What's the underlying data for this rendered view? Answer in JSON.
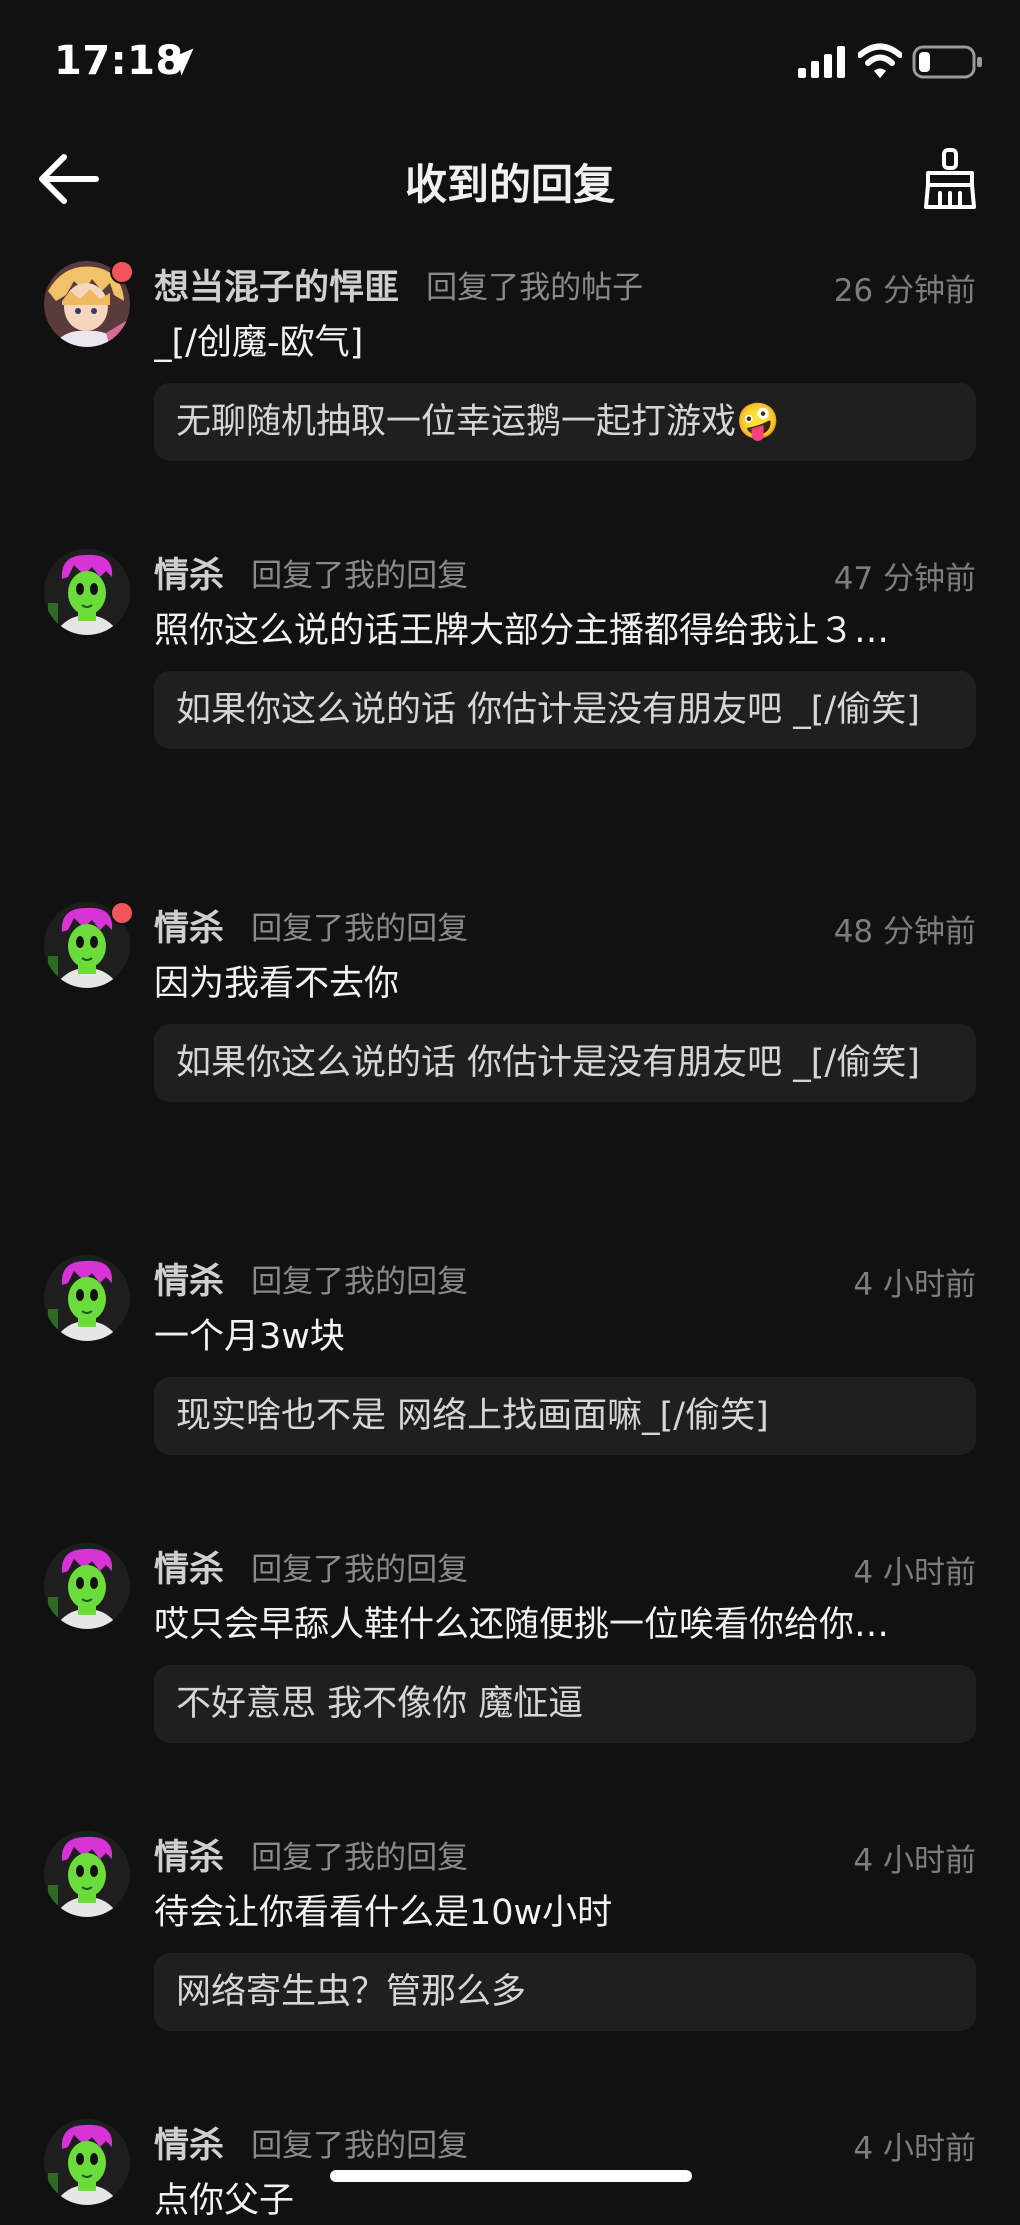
{
  "status_bar": {
    "time": "17:18"
  },
  "nav": {
    "title": "收到的回复"
  },
  "colors": {
    "background": "#111111",
    "quote_background": "#1f1f1f",
    "unread_dot": "#f2545b",
    "avatar_green": "#6bdc3b",
    "avatar_magenta": "#d833d6"
  },
  "replies": [
    {
      "avatar": "anime-blond-avatar",
      "unread": true,
      "username": "想当混子的悍匪",
      "action": "回复了我的帖子",
      "time": "26 分钟前",
      "text": "_[/创魔-欧气]",
      "quote": "无聊随机抽取一位幸运鹅一起打游戏🤪"
    },
    {
      "avatar": "green-magenta-avatar",
      "unread": false,
      "username": "情杀",
      "action": "回复了我的回复",
      "time": "47 分钟前",
      "text": "照你这么说的话王牌大部分主播都得给我让３…",
      "quote": "如果你这么说的话 你估计是没有朋友吧 _[/偷笑]"
    },
    {
      "avatar": "green-magenta-avatar",
      "unread": true,
      "username": "情杀",
      "action": "回复了我的回复",
      "time": "48 分钟前",
      "text": "因为我看不去你",
      "quote": "如果你这么说的话 你估计是没有朋友吧 _[/偷笑]"
    },
    {
      "avatar": "green-magenta-avatar",
      "unread": false,
      "username": "情杀",
      "action": "回复了我的回复",
      "time": "4 小时前",
      "text": "一个月3w块",
      "quote": "现实啥也不是 网络上找画面嘛_[/偷笑]"
    },
    {
      "avatar": "green-magenta-avatar",
      "unread": false,
      "username": "情杀",
      "action": "回复了我的回复",
      "time": "4 小时前",
      "text": "哎只会早舔人鞋什么还随便挑一位唉看你给你…",
      "quote": "不好意思 我不像你 魔怔逼"
    },
    {
      "avatar": "green-magenta-avatar",
      "unread": false,
      "username": "情杀",
      "action": "回复了我的回复",
      "time": "4 小时前",
      "text": "待会让你看看什么是10w小时",
      "quote": "网络寄生虫？管那么多"
    },
    {
      "avatar": "green-magenta-avatar",
      "unread": false,
      "username": "情杀",
      "action": "回复了我的回复",
      "time": "4 小时前",
      "text": "点你父子",
      "quote": ""
    }
  ]
}
